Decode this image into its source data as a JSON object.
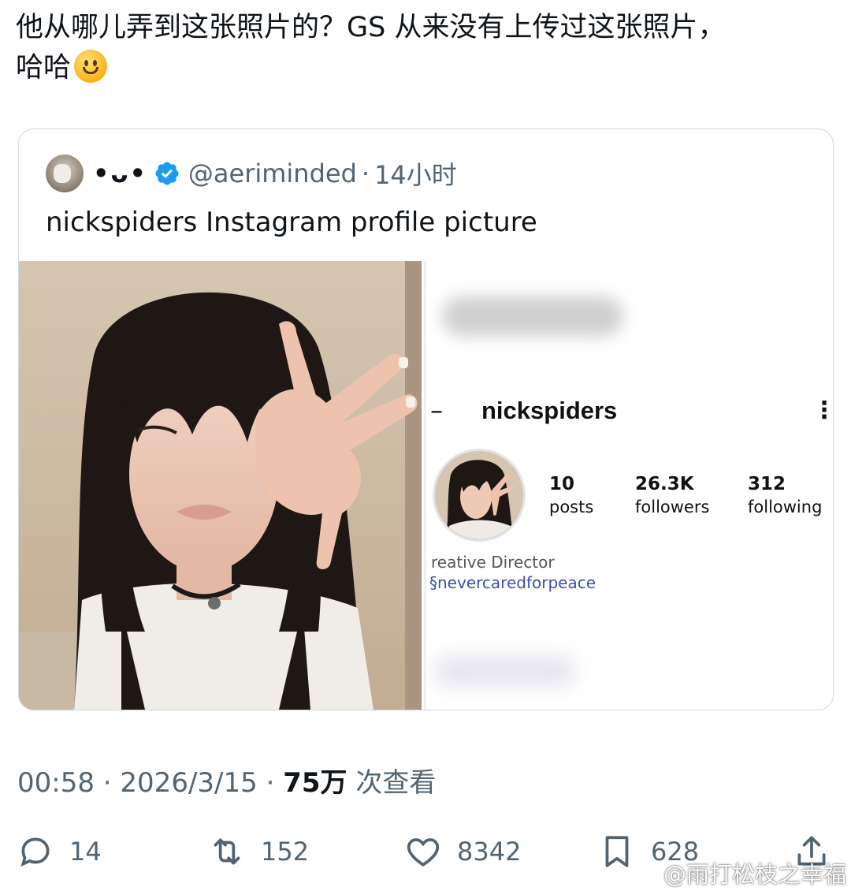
{
  "tweet": {
    "text_line1": "他从哪儿弄到这张照片的？GS 从来没有上传过这张照片，",
    "text_line2": "哈哈",
    "emoji": "slightly-smiling-face-icon"
  },
  "quoted_tweet": {
    "display_name": "•ᴗ•",
    "handle": "@aeriminded",
    "separator": "·",
    "time": "14小时",
    "text": "nickspiders Instagram profile picture",
    "verified_color": "#1d9bf0"
  },
  "instagram_screenshot": {
    "back_symbol": "–",
    "username": "nickspiders",
    "menu_symbol": "⋮",
    "stats": [
      {
        "value": "10",
        "label": "posts"
      },
      {
        "value": "26.3K",
        "label": "followers"
      },
      {
        "value": "312",
        "label": "following"
      }
    ],
    "bio_line1": "reative Director",
    "bio_link": "§nevercaredforpeace"
  },
  "meta": {
    "time": "00:58",
    "dot1": "·",
    "date": "2026/3/15",
    "dot2": "·",
    "views": "75万",
    "views_label": "次查看"
  },
  "actions": {
    "reply_count": "14",
    "retweet_count": "152",
    "like_count": "8342",
    "bookmark_count": "628"
  },
  "watermark": {
    "text": "@雨打松枝之幸福"
  },
  "colors": {
    "text": "#0f1419",
    "secondary": "#536471",
    "border": "#cfd9de",
    "accent": "#1d9bf0",
    "ig_link": "#3b4fae"
  }
}
